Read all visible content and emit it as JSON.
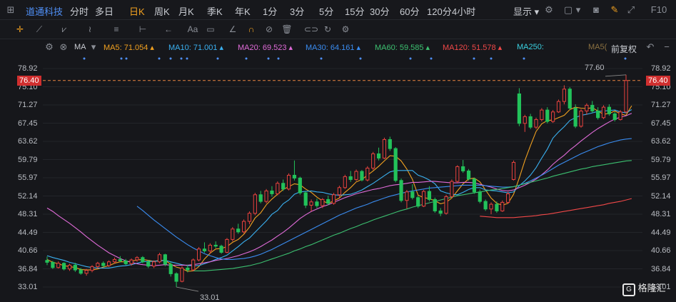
{
  "stock_name": "道通科技",
  "periods": [
    "分时",
    "多日",
    "日K",
    "周K",
    "月K",
    "季K",
    "年K",
    "1分",
    "3分",
    "5分",
    "15分",
    "30分",
    "60分",
    "120分",
    "4小时"
  ],
  "active_period": "日K",
  "display_label": "显示",
  "indicator": {
    "name": "MA",
    "items": [
      {
        "label": "MA5: 71.054",
        "color": "#f0a020"
      },
      {
        "label": "MA10: 71.001",
        "color": "#3ab0f0"
      },
      {
        "label": "MA20: 69.523",
        "color": "#e06bd8"
      },
      {
        "label": "MA30: 64.161",
        "color": "#3a8cf0"
      },
      {
        "label": "MA60: 59.585",
        "color": "#3cc070"
      },
      {
        "label": "MA120: 51.578",
        "color": "#f04848"
      },
      {
        "label": "MA250:",
        "color": "#3ad0e0"
      },
      {
        "label": "MA5(",
        "color": "#8a7040"
      }
    ],
    "adjust": "前复权"
  },
  "y_axis": {
    "labels": [
      "78.92",
      "75.10",
      "71.27",
      "67.45",
      "63.62",
      "59.79",
      "55.97",
      "52.14",
      "48.31",
      "44.49",
      "40.66",
      "36.84",
      "33.01"
    ]
  },
  "current_price": "76.40",
  "annotations": {
    "high": "77.60",
    "low": "33.01"
  },
  "watermark": "格隆汇",
  "colors": {
    "up": "#e8423e",
    "down": "#22c25a",
    "accent": "#f0a020",
    "link": "#4f8ff5"
  },
  "chart_data": {
    "type": "candlestick",
    "ylim": [
      33.01,
      78.92
    ],
    "candles": [
      [
        38.6,
        39.4,
        37.6,
        38.2
      ],
      [
        38.2,
        38.5,
        36.8,
        37.1
      ],
      [
        37.1,
        38.4,
        36.9,
        38.0
      ],
      [
        38.0,
        38.2,
        36.5,
        36.8
      ],
      [
        36.8,
        37.9,
        36.4,
        37.6
      ],
      [
        37.6,
        38.1,
        36.2,
        36.6
      ],
      [
        36.6,
        37.0,
        35.6,
        35.9
      ],
      [
        35.9,
        36.8,
        35.4,
        36.5
      ],
      [
        36.5,
        37.6,
        36.1,
        37.3
      ],
      [
        37.3,
        38.3,
        36.9,
        38.0
      ],
      [
        38.0,
        38.4,
        37.2,
        37.5
      ],
      [
        37.5,
        38.6,
        37.2,
        38.3
      ],
      [
        38.3,
        39.2,
        37.9,
        38.8
      ],
      [
        38.8,
        39.5,
        38.2,
        38.5
      ],
      [
        38.5,
        38.9,
        37.6,
        37.9
      ],
      [
        37.9,
        39.0,
        37.5,
        38.7
      ],
      [
        38.7,
        39.5,
        38.3,
        39.2
      ],
      [
        39.2,
        39.5,
        38.0,
        38.3
      ],
      [
        38.3,
        38.7,
        37.0,
        37.4
      ],
      [
        37.4,
        38.6,
        37.0,
        38.3
      ],
      [
        38.3,
        40.2,
        38.0,
        39.8
      ],
      [
        39.8,
        40.0,
        37.4,
        37.8
      ],
      [
        37.8,
        38.3,
        35.2,
        35.8
      ],
      [
        35.8,
        36.1,
        33.0,
        34.2
      ],
      [
        34.2,
        37.4,
        34.0,
        37.0
      ],
      [
        37.0,
        37.7,
        36.1,
        36.6
      ],
      [
        36.6,
        39.0,
        36.3,
        38.7
      ],
      [
        38.7,
        41.4,
        38.4,
        41.0
      ],
      [
        41.0,
        42.4,
        40.2,
        40.6
      ],
      [
        40.6,
        42.2,
        40.0,
        41.8
      ],
      [
        41.8,
        42.6,
        41.2,
        41.6
      ],
      [
        41.6,
        41.9,
        40.0,
        40.3
      ],
      [
        40.3,
        43.3,
        40.1,
        43.0
      ],
      [
        43.0,
        45.6,
        42.6,
        45.2
      ],
      [
        45.2,
        46.3,
        44.2,
        44.6
      ],
      [
        44.6,
        47.2,
        44.3,
        46.8
      ],
      [
        46.8,
        48.9,
        46.2,
        48.5
      ],
      [
        48.5,
        52.8,
        48.1,
        52.4
      ],
      [
        52.4,
        53.2,
        50.6,
        51.0
      ],
      [
        51.0,
        53.6,
        50.6,
        53.2
      ],
      [
        53.2,
        54.2,
        52.0,
        52.6
      ],
      [
        52.6,
        55.2,
        52.3,
        54.8
      ],
      [
        54.8,
        55.6,
        53.2,
        53.6
      ],
      [
        53.6,
        56.9,
        53.3,
        56.5
      ],
      [
        56.5,
        59.6,
        55.4,
        55.9
      ],
      [
        55.9,
        56.2,
        52.4,
        52.8
      ],
      [
        52.8,
        53.1,
        49.6,
        50.2
      ],
      [
        50.2,
        51.4,
        48.9,
        50.9
      ],
      [
        50.9,
        51.6,
        49.6,
        50.1
      ],
      [
        50.1,
        51.7,
        49.6,
        51.4
      ],
      [
        51.4,
        52.2,
        50.2,
        50.6
      ],
      [
        50.6,
        52.8,
        50.3,
        52.4
      ],
      [
        52.4,
        54.3,
        51.8,
        53.9
      ],
      [
        53.9,
        56.6,
        53.6,
        56.2
      ],
      [
        56.2,
        57.4,
        55.1,
        55.6
      ],
      [
        55.6,
        57.7,
        55.3,
        57.3
      ],
      [
        57.3,
        57.6,
        55.2,
        55.5
      ],
      [
        55.5,
        58.4,
        55.2,
        58.0
      ],
      [
        58.0,
        61.4,
        57.6,
        61.0
      ],
      [
        61.0,
        62.3,
        59.6,
        60.1
      ],
      [
        60.1,
        64.4,
        59.9,
        64.0
      ],
      [
        64.0,
        64.6,
        61.6,
        62.1
      ],
      [
        62.1,
        62.4,
        55.0,
        55.4
      ],
      [
        55.4,
        55.8,
        50.8,
        51.2
      ],
      [
        51.2,
        53.4,
        49.5,
        53.0
      ],
      [
        53.0,
        54.6,
        51.4,
        51.8
      ],
      [
        51.8,
        52.2,
        49.6,
        50.0
      ],
      [
        50.0,
        53.4,
        49.8,
        53.1
      ],
      [
        53.1,
        54.2,
        51.0,
        51.4
      ],
      [
        51.4,
        51.8,
        48.6,
        49.0
      ],
      [
        49.0,
        49.6,
        47.9,
        48.5
      ],
      [
        48.5,
        52.4,
        48.2,
        52.0
      ],
      [
        52.0,
        55.6,
        51.7,
        55.2
      ],
      [
        55.2,
        58.6,
        54.9,
        58.3
      ],
      [
        58.3,
        59.7,
        57.0,
        57.4
      ],
      [
        57.4,
        57.8,
        55.4,
        55.7
      ],
      [
        55.7,
        56.0,
        52.6,
        53.0
      ],
      [
        53.0,
        53.5,
        50.6,
        51.0
      ],
      [
        51.0,
        51.4,
        49.0,
        49.4
      ],
      [
        49.4,
        50.8,
        48.3,
        50.4
      ],
      [
        50.4,
        51.0,
        48.6,
        49.0
      ],
      [
        49.0,
        51.2,
        48.8,
        50.8
      ],
      [
        50.8,
        53.0,
        50.5,
        52.6
      ],
      [
        55.6,
        59.6,
        55.4,
        59.2
      ],
      [
        73.6,
        74.8,
        66.8,
        67.4
      ],
      [
        67.4,
        69.2,
        65.6,
        68.8
      ],
      [
        68.8,
        69.4,
        66.2,
        66.6
      ],
      [
        66.6,
        68.6,
        66.2,
        68.2
      ],
      [
        68.2,
        70.6,
        67.8,
        70.2
      ],
      [
        70.2,
        70.8,
        67.4,
        67.8
      ],
      [
        67.8,
        70.2,
        67.5,
        69.8
      ],
      [
        69.8,
        72.4,
        69.6,
        72.0
      ],
      [
        72.0,
        75.4,
        71.4,
        74.6
      ],
      [
        74.6,
        75.0,
        70.2,
        70.6
      ],
      [
        70.6,
        71.4,
        66.4,
        66.8
      ],
      [
        66.8,
        70.4,
        66.5,
        70.0
      ],
      [
        70.0,
        71.6,
        69.2,
        71.2
      ],
      [
        71.2,
        72.1,
        69.6,
        70.0
      ],
      [
        70.0,
        70.8,
        68.2,
        68.6
      ],
      [
        68.6,
        71.2,
        68.3,
        70.8
      ],
      [
        70.8,
        71.4,
        69.0,
        69.4
      ],
      [
        69.4,
        69.8,
        67.8,
        68.2
      ],
      [
        68.2,
        70.2,
        68.0,
        69.8
      ],
      [
        69.8,
        77.6,
        69.5,
        76.4
      ]
    ],
    "ma_series": [
      {
        "name": "MA5",
        "color": "#f0a020",
        "values": [
          38.8,
          38.2,
          37.9,
          37.5,
          37.3,
          37.1,
          36.7,
          36.6,
          36.6,
          36.8,
          37.2,
          37.5,
          38.0,
          38.3,
          38.3,
          38.4,
          38.7,
          38.8,
          38.6,
          38.4,
          38.6,
          38.6,
          37.8,
          37.2,
          36.9,
          36.3,
          36.4,
          37.3,
          38.9,
          40.1,
          41.0,
          41.1,
          41.5,
          42.4,
          43.0,
          44.1,
          45.6,
          47.5,
          48.6,
          50.3,
          51.5,
          52.5,
          53.5,
          54.1,
          54.7,
          54.5,
          53.6,
          52.9,
          51.9,
          51.1,
          50.6,
          51.1,
          51.7,
          52.9,
          53.9,
          55.1,
          55.6,
          56.5,
          57.4,
          58.4,
          59.5,
          60.6,
          60.5,
          59.5,
          57.8,
          55.6,
          52.3,
          51.8,
          51.6,
          51.1,
          50.5,
          50.8,
          51.7,
          53.2,
          54.7,
          55.7,
          55.9,
          55.1,
          53.4,
          51.7,
          50.6,
          50.2,
          50.6,
          52.5,
          55.9,
          59.6,
          62.7,
          65.7,
          67.3,
          68.0,
          68.1,
          68.6,
          69.1,
          70.3,
          70.8,
          70.6,
          70.5,
          70.7,
          70.0,
          69.3,
          69.5,
          70.0,
          69.4,
          69.1,
          71.1
        ]
      },
      {
        "name": "MA10",
        "color": "#3ab0f0",
        "values": [
          39.6,
          39.2,
          38.9,
          38.6,
          38.2,
          37.9,
          37.6,
          37.3,
          37.1,
          37.0,
          37.0,
          37.0,
          37.2,
          37.4,
          37.5,
          37.7,
          38.0,
          38.3,
          38.4,
          38.4,
          38.5,
          38.6,
          38.3,
          38.0,
          37.7,
          37.5,
          37.5,
          37.5,
          37.9,
          38.3,
          38.8,
          39.2,
          39.7,
          40.6,
          41.5,
          42.5,
          43.3,
          44.5,
          45.7,
          46.9,
          48.3,
          49.1,
          50.5,
          51.3,
          52.5,
          53.0,
          53.1,
          53.2,
          53.0,
          52.9,
          52.6,
          52.4,
          52.3,
          52.4,
          52.5,
          52.9,
          53.4,
          54.1,
          54.8,
          55.6,
          56.4,
          57.2,
          57.5,
          57.5,
          57.5,
          57.5,
          56.5,
          56.1,
          55.5,
          54.7,
          53.2,
          52.8,
          52.5,
          52.4,
          52.9,
          53.5,
          53.9,
          53.9,
          53.4,
          53.3,
          53.2,
          53.0,
          52.8,
          53.0,
          54.3,
          55.3,
          56.5,
          58.1,
          60.1,
          62.0,
          64.3,
          65.6,
          66.7,
          68.0,
          68.6,
          69.1,
          69.3,
          69.6,
          69.9,
          70.0,
          70.1,
          70.2,
          69.8,
          69.6,
          70.3
        ]
      },
      {
        "name": "MA20",
        "color": "#e06bd8",
        "values": [
          49.6,
          48.9,
          48.0,
          47.2,
          46.4,
          45.5,
          44.6,
          43.6,
          42.7,
          41.8,
          41.0,
          40.2,
          39.6,
          39.0,
          38.5,
          38.2,
          37.9,
          37.7,
          37.6,
          37.5,
          37.6,
          37.7,
          37.6,
          37.6,
          37.6,
          37.6,
          37.7,
          37.9,
          38.1,
          38.3,
          38.6,
          38.8,
          39.0,
          39.3,
          39.6,
          40.0,
          40.4,
          40.9,
          41.5,
          42.2,
          42.9,
          43.7,
          44.5,
          45.4,
          46.4,
          47.4,
          48.2,
          48.9,
          49.4,
          49.9,
          50.3,
          50.8,
          51.3,
          51.8,
          52.2,
          52.6,
          52.9,
          53.2,
          53.5,
          53.7,
          54.0,
          54.3,
          54.5,
          54.6,
          54.8,
          55.0,
          55.0,
          55.1,
          55.2,
          55.2,
          55.1,
          55.0,
          54.9,
          54.9,
          55.0,
          55.0,
          54.9,
          54.6,
          54.3,
          54.0,
          53.6,
          53.3,
          53.2,
          53.4,
          53.9,
          54.4,
          55.0,
          55.7,
          56.6,
          57.6,
          58.8,
          59.8,
          60.7,
          61.8,
          62.7,
          63.7,
          64.6,
          65.5,
          66.3,
          67.0,
          67.7,
          68.3,
          68.7,
          69.0,
          69.5
        ]
      },
      {
        "name": "MA30",
        "color": "#3a8cf0",
        "values": [
          null,
          null,
          null,
          null,
          null,
          null,
          null,
          null,
          null,
          null,
          null,
          null,
          null,
          null,
          null,
          null,
          50.0,
          49.1,
          48.1,
          47.1,
          46.2,
          45.3,
          44.4,
          43.5,
          42.7,
          41.9,
          41.2,
          40.6,
          40.0,
          39.6,
          39.2,
          38.9,
          38.8,
          38.8,
          38.9,
          39.0,
          39.2,
          39.5,
          39.9,
          40.4,
          40.9,
          41.5,
          42.1,
          42.7,
          43.3,
          43.9,
          44.5,
          45.1,
          45.7,
          46.3,
          46.9,
          47.5,
          48.1,
          48.6,
          49.1,
          49.6,
          50.0,
          50.4,
          50.9,
          51.3,
          51.7,
          52.1,
          52.4,
          52.7,
          53.0,
          53.2,
          53.4,
          53.6,
          53.8,
          53.9,
          54.0,
          54.1,
          54.2,
          54.3,
          54.4,
          54.4,
          54.4,
          54.4,
          54.3,
          54.2,
          54.1,
          54.0,
          54.0,
          54.1,
          54.4,
          54.8,
          55.3,
          55.9,
          56.5,
          57.2,
          57.9,
          58.6,
          59.2,
          59.8,
          60.4,
          61.0,
          61.5,
          62.0,
          62.5,
          62.9,
          63.3,
          63.6,
          63.9,
          64.1,
          64.2
        ]
      },
      {
        "name": "MA60",
        "color": "#3cc070",
        "values": [
          null,
          null,
          null,
          null,
          null,
          null,
          null,
          null,
          null,
          null,
          null,
          null,
          null,
          null,
          null,
          null,
          null,
          null,
          null,
          null,
          null,
          null,
          null,
          null,
          null,
          null,
          36.4,
          36.4,
          36.4,
          36.5,
          36.6,
          36.7,
          36.8,
          36.9,
          37.1,
          37.3,
          37.5,
          37.8,
          38.1,
          38.5,
          38.9,
          39.3,
          39.7,
          40.1,
          40.6,
          41.0,
          41.5,
          41.9,
          42.4,
          42.9,
          43.4,
          43.9,
          44.3,
          44.8,
          45.3,
          45.7,
          46.2,
          46.6,
          47.1,
          47.5,
          47.9,
          48.3,
          48.7,
          49.1,
          49.4,
          49.8,
          50.1,
          50.4,
          50.7,
          51.0,
          51.3,
          51.6,
          51.9,
          52.2,
          52.4,
          52.6,
          52.8,
          53.0,
          53.2,
          53.4,
          53.5,
          53.7,
          53.9,
          54.1,
          54.4,
          54.7,
          55.0,
          55.3,
          55.6,
          55.9,
          56.3,
          56.6,
          56.9,
          57.2,
          57.5,
          57.8,
          58.0,
          58.3,
          58.5,
          58.7,
          58.9,
          59.1,
          59.3,
          59.5,
          59.6
        ]
      },
      {
        "name": "MA120",
        "color": "#f04848",
        "values": [
          null,
          null,
          null,
          null,
          null,
          null,
          null,
          null,
          null,
          null,
          null,
          null,
          null,
          null,
          null,
          null,
          null,
          null,
          null,
          null,
          null,
          null,
          null,
          null,
          null,
          null,
          null,
          null,
          null,
          null,
          null,
          null,
          null,
          null,
          null,
          null,
          null,
          null,
          null,
          null,
          null,
          null,
          null,
          null,
          null,
          null,
          null,
          null,
          null,
          null,
          null,
          null,
          null,
          null,
          null,
          null,
          null,
          null,
          null,
          null,
          null,
          null,
          null,
          null,
          null,
          null,
          null,
          null,
          null,
          null,
          null,
          null,
          null,
          null,
          null,
          null,
          null,
          47.9,
          47.8,
          47.7,
          47.6,
          47.6,
          47.6,
          47.6,
          47.7,
          47.8,
          47.9,
          48.0,
          48.2,
          48.3,
          48.5,
          48.7,
          48.9,
          49.1,
          49.3,
          49.5,
          49.7,
          49.9,
          50.1,
          50.3,
          50.6,
          50.8,
          51.0,
          51.3,
          51.6
        ]
      }
    ]
  }
}
